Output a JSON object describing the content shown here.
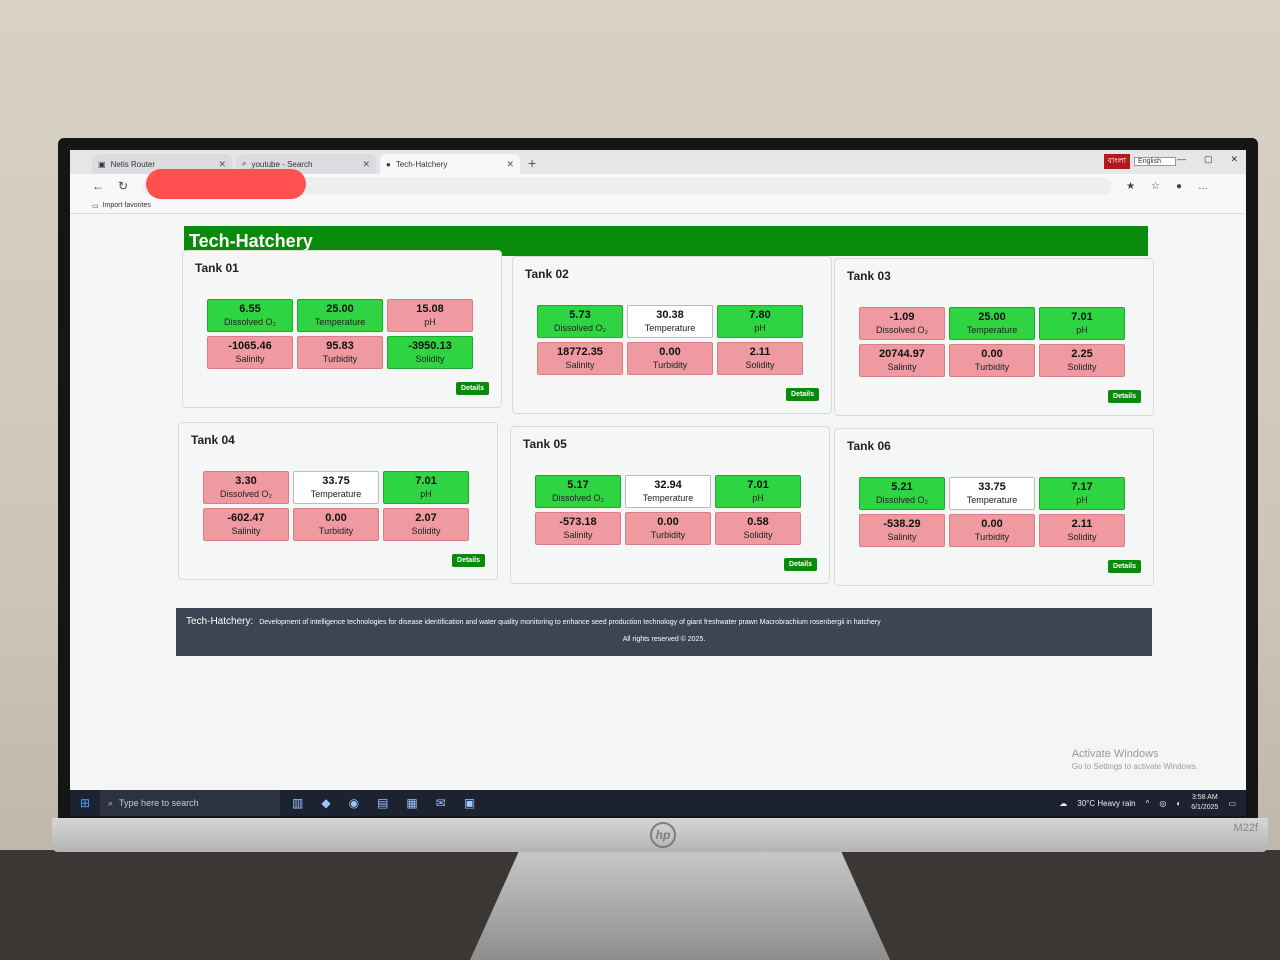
{
  "browser": {
    "tabs": [
      {
        "title": "Netis Router",
        "active": false
      },
      {
        "title": "youtube - Search",
        "active": false
      },
      {
        "title": "Tech-Hatchery",
        "active": true
      }
    ],
    "ime_label": "বাংলা",
    "language": "English",
    "favorites_label": "Import favorites"
  },
  "app": {
    "title": "Tech-Hatchery",
    "details_label": "Details",
    "colors": {
      "good": "#2fd443",
      "bad": "#ee9aa0",
      "neutral": "#ffffff",
      "header": "#0a8a0a"
    }
  },
  "tanks": [
    {
      "name": "Tank 01",
      "metrics": [
        {
          "value": "6.55",
          "label": "Dissolved O₂",
          "status": "good"
        },
        {
          "value": "25.00",
          "label": "Temperature",
          "status": "good"
        },
        {
          "value": "15.08",
          "label": "pH",
          "status": "bad"
        },
        {
          "value": "-1065.46",
          "label": "Salinity",
          "status": "bad"
        },
        {
          "value": "95.83",
          "label": "Turbidity",
          "status": "bad"
        },
        {
          "value": "-3950.13",
          "label": "Solidity",
          "status": "good"
        }
      ]
    },
    {
      "name": "Tank 02",
      "metrics": [
        {
          "value": "5.73",
          "label": "Dissolved O₂",
          "status": "good"
        },
        {
          "value": "30.38",
          "label": "Temperature",
          "status": "neutral"
        },
        {
          "value": "7.80",
          "label": "pH",
          "status": "good"
        },
        {
          "value": "18772.35",
          "label": "Salinity",
          "status": "bad"
        },
        {
          "value": "0.00",
          "label": "Turbidity",
          "status": "bad"
        },
        {
          "value": "2.11",
          "label": "Solidity",
          "status": "bad"
        }
      ]
    },
    {
      "name": "Tank 03",
      "metrics": [
        {
          "value": "-1.09",
          "label": "Dissolved O₂",
          "status": "bad"
        },
        {
          "value": "25.00",
          "label": "Temperature",
          "status": "good"
        },
        {
          "value": "7.01",
          "label": "pH",
          "status": "good"
        },
        {
          "value": "20744.97",
          "label": "Salinity",
          "status": "bad"
        },
        {
          "value": "0.00",
          "label": "Turbidity",
          "status": "bad"
        },
        {
          "value": "2.25",
          "label": "Solidity",
          "status": "bad"
        }
      ]
    },
    {
      "name": "Tank 04",
      "metrics": [
        {
          "value": "3.30",
          "label": "Dissolved O₂",
          "status": "bad"
        },
        {
          "value": "33.75",
          "label": "Temperature",
          "status": "neutral"
        },
        {
          "value": "7.01",
          "label": "pH",
          "status": "good"
        },
        {
          "value": "-602.47",
          "label": "Salinity",
          "status": "bad"
        },
        {
          "value": "0.00",
          "label": "Turbidity",
          "status": "bad"
        },
        {
          "value": "2.07",
          "label": "Solidity",
          "status": "bad"
        }
      ]
    },
    {
      "name": "Tank 05",
      "metrics": [
        {
          "value": "5.17",
          "label": "Dissolved O₂",
          "status": "good"
        },
        {
          "value": "32.94",
          "label": "Temperature",
          "status": "neutral"
        },
        {
          "value": "7.01",
          "label": "pH",
          "status": "good"
        },
        {
          "value": "-573.18",
          "label": "Salinity",
          "status": "bad"
        },
        {
          "value": "0.00",
          "label": "Turbidity",
          "status": "bad"
        },
        {
          "value": "0.58",
          "label": "Solidity",
          "status": "bad"
        }
      ]
    },
    {
      "name": "Tank 06",
      "metrics": [
        {
          "value": "5.21",
          "label": "Dissolved O₂",
          "status": "good"
        },
        {
          "value": "33.75",
          "label": "Temperature",
          "status": "neutral"
        },
        {
          "value": "7.17",
          "label": "pH",
          "status": "good"
        },
        {
          "value": "-538.29",
          "label": "Salinity",
          "status": "bad"
        },
        {
          "value": "0.00",
          "label": "Turbidity",
          "status": "bad"
        },
        {
          "value": "2.11",
          "label": "Solidity",
          "status": "bad"
        }
      ]
    }
  ],
  "footer": {
    "brand": "Tech-Hatchery:",
    "description": "Development of intelligence technologies for disease identification and water quality monitoring to enhance seed production technology of giant freshwater prawn Macrobrachium rosenbergii in hatchery",
    "copyright": "All rights reserved © 2025."
  },
  "windows": {
    "activate_title": "Activate Windows",
    "activate_sub": "Go to Settings to activate Windows."
  },
  "taskbar": {
    "search_placeholder": "Type here to search",
    "weather": "30°C  Heavy rain",
    "time": "3:58 AM",
    "date": "6/1/2025"
  },
  "monitor": {
    "model": "M22f"
  }
}
